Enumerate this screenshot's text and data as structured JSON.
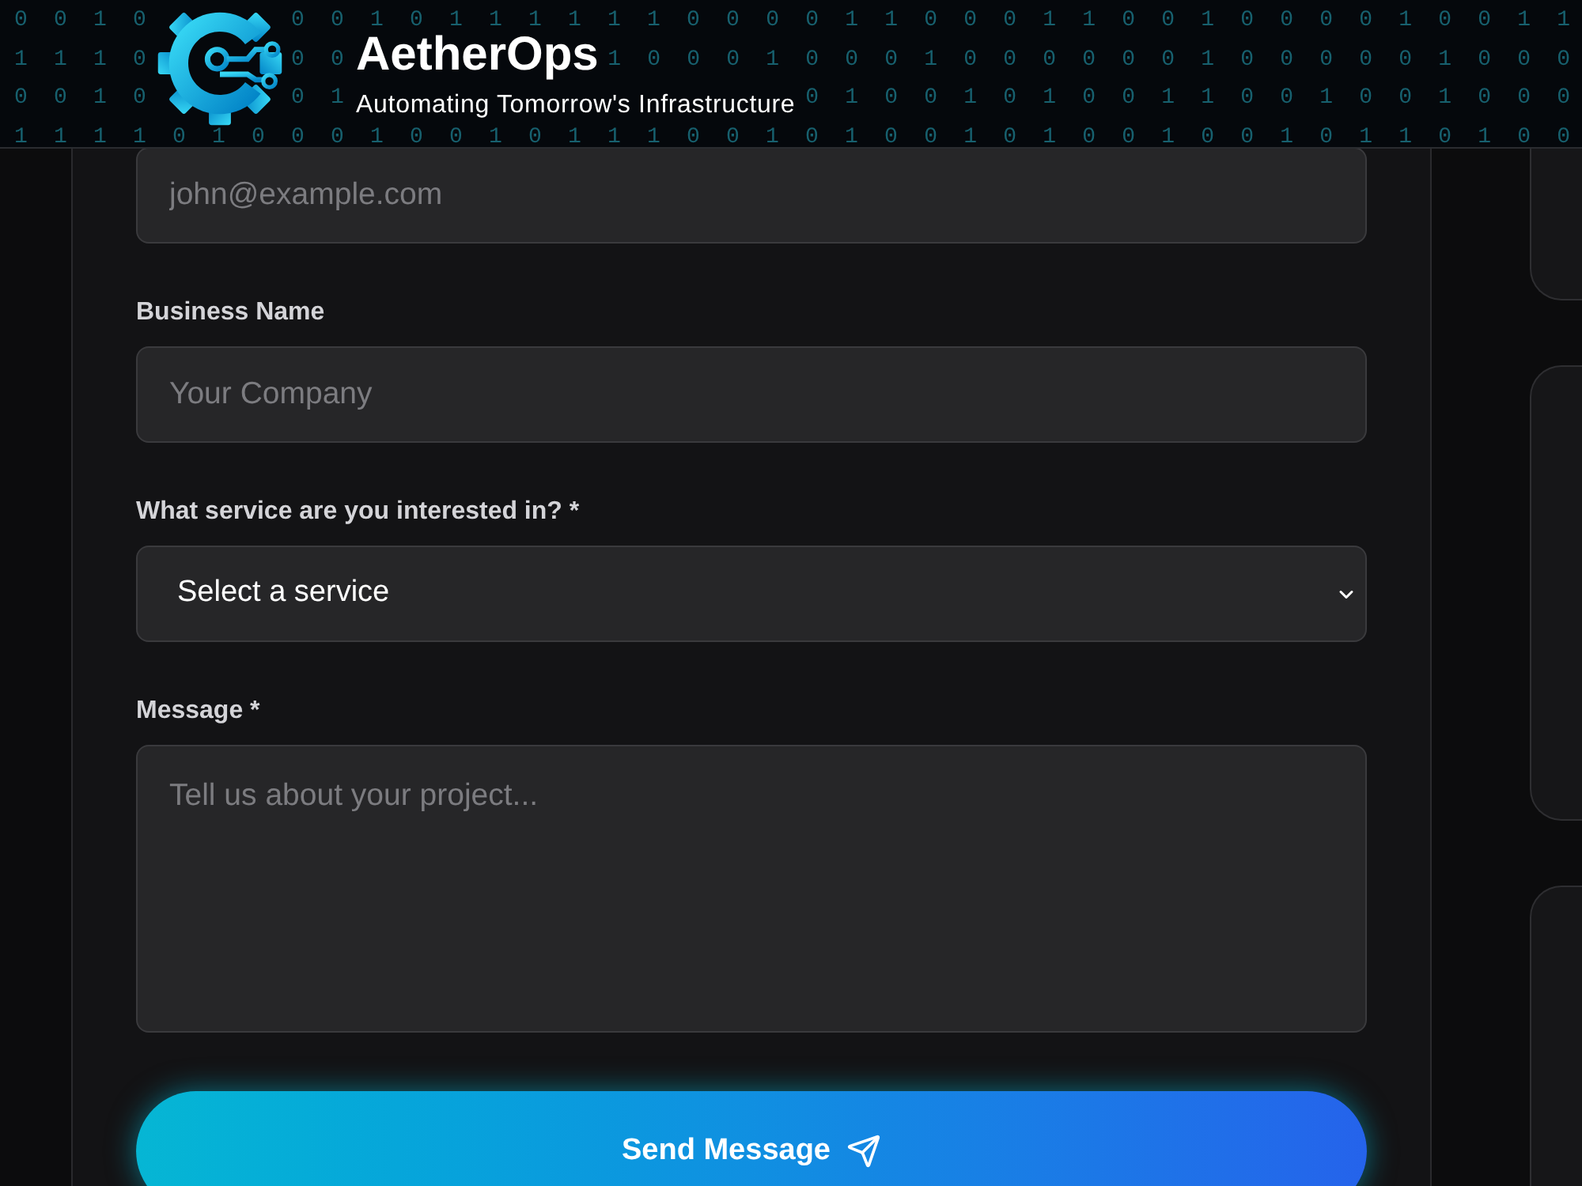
{
  "header": {
    "title": "AetherOps",
    "tagline": "Automating Tomorrow's Infrastructure",
    "binary_rows": [
      "0 0 1 0       0 0 1 0 1 1 1 1 1 1 0 0 0 0 1 1 0 0 0 1 1 0 0 1 0 0 0 0 1 0 0 1 1",
      "1 1 1 0       0 0             1 0 0 0 1 0 0 0 1 0 0 0 0 0 0 1 0 0 0 0 0 1 0 0 0",
      "0 0 1 0       0 1                       0 1 0 0 1 0 1 0 0 1 1 0 0 1 0 0 1 0 0 0",
      "1 1 1 1 0 1 0 0 0 1 0 0 1 0 1 1 1 0 0 1 0 1 0 0 1 0 1 0 0 1 0 0 1 0 1 1 0 1 0 0"
    ]
  },
  "form": {
    "fields": [
      {
        "kind": "input",
        "placeholder": "john@example.com"
      },
      {
        "kind": "input",
        "label": "Business Name",
        "placeholder": "Your Company"
      },
      {
        "kind": "select",
        "label": "What service are you interested in? *",
        "value": "Select a service"
      },
      {
        "kind": "textarea",
        "label": "Message *",
        "placeholder": "Tell us about your project..."
      }
    ],
    "submit": {
      "label": "Send Message"
    }
  }
}
